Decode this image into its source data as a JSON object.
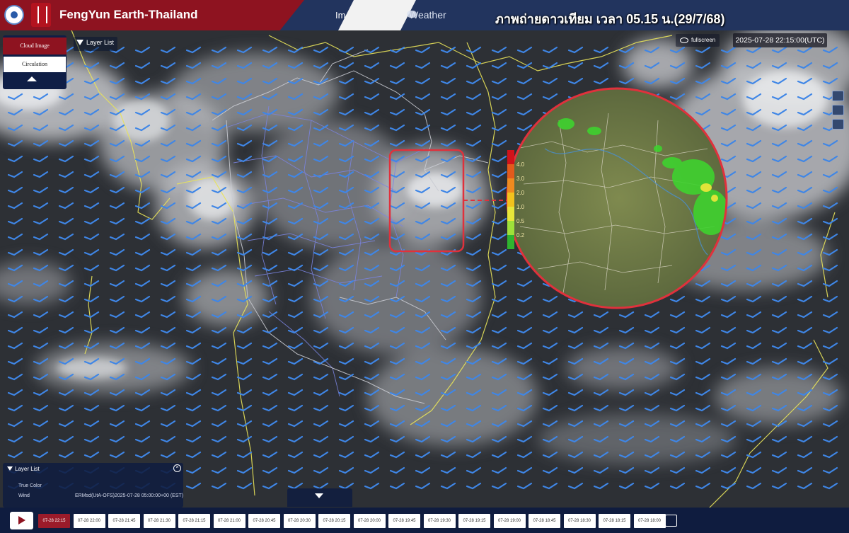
{
  "header": {
    "app_title": "FengYun Earth-Thailand",
    "nav_home_label": "Im",
    "nav_weather_label": "Weather",
    "caption": "ภาพถ่ายดาวเทียม เวลา 05.15 น.(29/7/68)"
  },
  "controls": {
    "cloud_image_label": "Cloud Image",
    "circulation_label": "Circulation",
    "layer_list_label": "Layer List",
    "fullscreen_label": "fullscreen",
    "timestamp": "2025-07-28 22:15:00(UTC)"
  },
  "radar_legend": {
    "values": [
      "4.0",
      "3.0",
      "2.0",
      "1.0",
      "0.5",
      "0.2"
    ],
    "colors": [
      "#d1131a",
      "#e35a1c",
      "#ef8a1f",
      "#f2c21d",
      "#e8e63a",
      "#9fe03a",
      "#2fb42f"
    ]
  },
  "layer_panel": {
    "title": "Layer List",
    "rows": [
      {
        "name": "True Color",
        "product": "",
        "time": ""
      },
      {
        "name": "Wind",
        "product": "ERMsd(UtA-OFS)",
        "time": "2025-07-28 05:00:00+00 (EST)"
      }
    ]
  },
  "timeline": {
    "times": [
      "07-28 22:15",
      "07-28 22:00",
      "07-28 21:45",
      "07-28 21:30",
      "07-28 21:15",
      "07-28 21:00",
      "07-28 20:45",
      "07-28 20:30",
      "07-28 20:15",
      "07-28 20:00",
      "07-28 19:45",
      "07-28 19:30",
      "07-28 19:15",
      "07-28 19:00",
      "07-28 18:45",
      "07-28 18:30",
      "07-28 18:15",
      "07-28 18:00"
    ],
    "active_index": 0
  },
  "colors": {
    "header_blue": "#22345e",
    "header_red": "#8e1320",
    "wind_barb": "#3f86e6",
    "coastline": "#e8e35a",
    "province_border": "#7b84e0",
    "highlight": "#e0313c"
  }
}
